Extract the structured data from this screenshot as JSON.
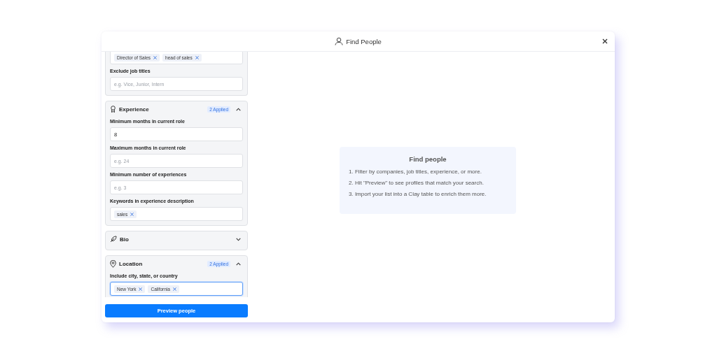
{
  "window": {
    "title": "Find People"
  },
  "sections": [
    {
      "kind": "partial",
      "fields": [
        {
          "kind": "tags",
          "tags": [
            "Director of Sales",
            "head of sales"
          ],
          "focused": false
        },
        {
          "kind": "text",
          "label": "Exclude job titles",
          "placeholder": "e.g. Vice, Junior, Intern",
          "focused": false
        }
      ]
    },
    {
      "kind": "card",
      "title": "Experience",
      "badge": "2 Applied",
      "expanded": true,
      "fields": [
        {
          "kind": "text",
          "label": "Minimum months in current role",
          "value": "8",
          "focused": false
        },
        {
          "kind": "text",
          "label": "Maximum months in current role",
          "placeholder": "e.g. 24",
          "focused": false
        },
        {
          "kind": "text",
          "label": "Minimum number of experiences",
          "placeholder": "e.g. 3",
          "focused": false
        },
        {
          "kind": "tags",
          "label": "Keywords in experience description",
          "tags": [
            "sales"
          ],
          "focused": false
        }
      ]
    },
    {
      "kind": "card",
      "title": "Bio",
      "expanded": false
    },
    {
      "kind": "card",
      "title": "Location",
      "badge": "2 Applied",
      "expanded": true,
      "fields": [
        {
          "kind": "tags",
          "label": "Include city, state, or country",
          "tags": [
            "New York",
            "California"
          ],
          "focused": true
        }
      ]
    }
  ],
  "preview_button": "Preview people",
  "info": {
    "title": "Find people",
    "steps": [
      "1. Filter by companies, job titles, experience, or more.",
      "2. Hit \"Preview\" to see profiles that match your search.",
      "3. Import your list into a Clay table to enrich them more."
    ]
  }
}
